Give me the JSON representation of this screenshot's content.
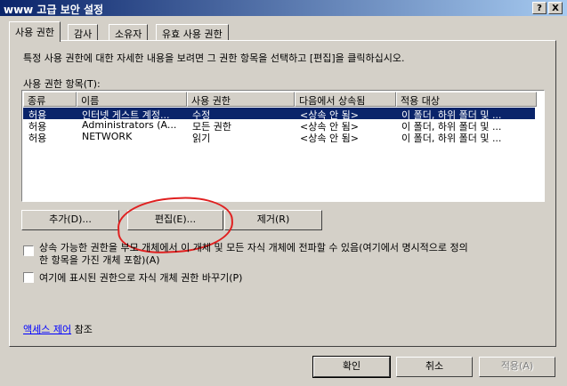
{
  "window": {
    "title": "www 고급 보안 설정",
    "help_glyph": "?",
    "close_glyph": "X"
  },
  "tabs": [
    "사용 권한",
    "감사",
    "소유자",
    "유효 사용 권한"
  ],
  "panel": {
    "description": "특정 사용 권한에 대한 자세한 내용을 보려면 그 권한 항목을 선택하고 [편집]을 클릭하십시오.",
    "entries_label": "사용 권한 항목(T):"
  },
  "table": {
    "columns": [
      "종류",
      "이름",
      "사용 권한",
      "다음에서 상속됨",
      "적용 대상"
    ],
    "rows": [
      [
        "허용",
        "인터넷 게스트 계정...",
        "수정",
        "<상속 안 됨>",
        "이 폴더, 하위 폴더 및 ..."
      ],
      [
        "허용",
        "Administrators (A...",
        "모든 권한",
        "<상속 안 됨>",
        "이 폴더, 하위 폴더 및 ..."
      ],
      [
        "허용",
        "NETWORK",
        "읽기",
        "<상속 안 됨>",
        "이 폴더, 하위 폴더 및 ..."
      ]
    ]
  },
  "buttons": {
    "add": "추가(D)...",
    "edit": "편집(E)...",
    "remove": "제거(R)"
  },
  "checkboxes": {
    "inherit_line1": "상속 가능한 권한을 부모 개체에서 이 개체 및 모든 자식 개체에 전파할 수 있음(여기에서 명시적으로 정의",
    "inherit_line2": "한 항목을 가진 개체 포함)(A)",
    "replace": "여기에 표시된 권한으로 자식 개체 권한 바꾸기(P)"
  },
  "access_control": {
    "link": "액세스 제어",
    "suffix": "참조"
  },
  "footer": {
    "ok": "확인",
    "cancel": "취소",
    "apply": "적용(A)"
  },
  "colors": {
    "selection": "#0a246a",
    "annotation": "#e02020",
    "face": "#d4d0c8"
  }
}
